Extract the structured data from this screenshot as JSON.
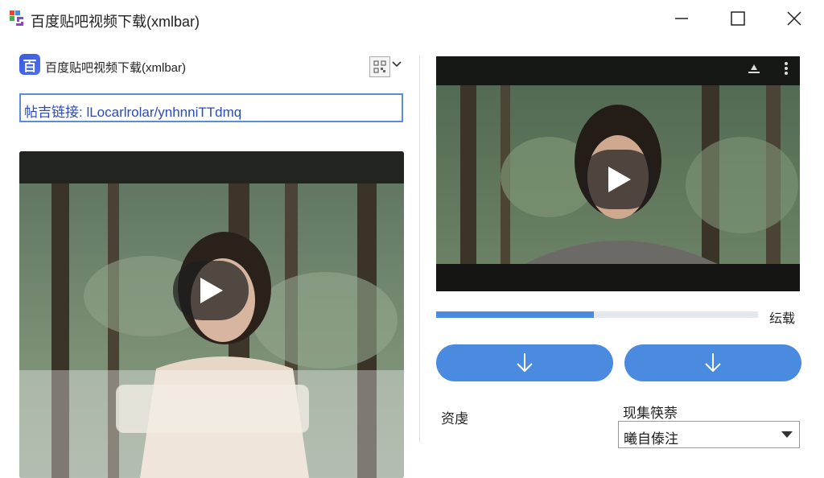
{
  "window": {
    "title": "百度贴吧视频下载(xmlbar)",
    "controls": [
      "minimize",
      "maximize",
      "close"
    ]
  },
  "left_panel": {
    "logo_glyph": "百",
    "title": "百度贴吧视频下载(xmlbar)",
    "url_field": {
      "value": "帖吉链接: lLocarlrolar/ynhnniTTdmq"
    },
    "thumbnail": {
      "play_icon": "play-icon"
    }
  },
  "right_panel": {
    "player": {
      "icons": [
        "cast-icon",
        "more-vertical-icon"
      ],
      "play_icon": "play-icon"
    },
    "progress": {
      "fraction": 0.49,
      "label": "纭载"
    },
    "buttons": [
      {
        "icon": "download-icon",
        "color": "#4a8be0"
      },
      {
        "icon": "download-icon",
        "color": "#4a8be0"
      }
    ],
    "quality_label": "资虔",
    "save_label": "现集筷萘",
    "save_select": {
      "value": "曦自傣注"
    }
  },
  "colors": {
    "accent": "#4a8be0",
    "url_border": "#5a8fd8",
    "url_text": "#2d4ab8"
  }
}
